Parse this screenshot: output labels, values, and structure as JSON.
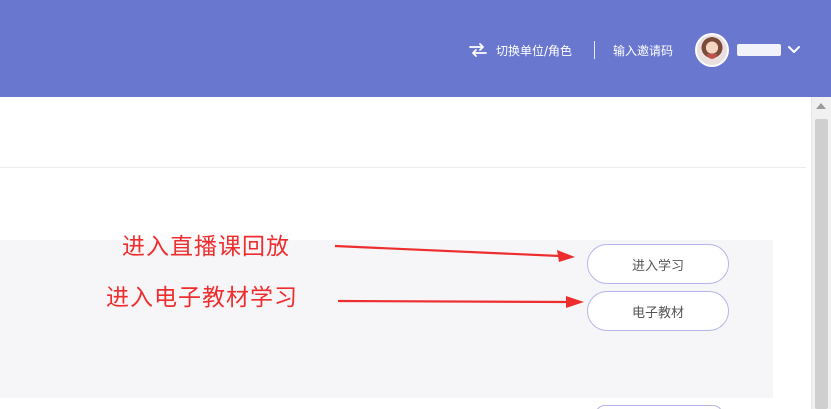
{
  "header": {
    "switch_role_label": "切换单位/角色",
    "invite_code_label": "输入邀请码"
  },
  "actions": {
    "enter_study_label": "进入学习",
    "ebook_label": "电子教材"
  },
  "annotations": {
    "replay_note": "进入直播课回放",
    "ebook_note": "进入电子教材学习"
  },
  "colors": {
    "header_bg": "#6a77cf",
    "annotation": "#ee2e2e",
    "button_border": "#b5b5ea"
  }
}
